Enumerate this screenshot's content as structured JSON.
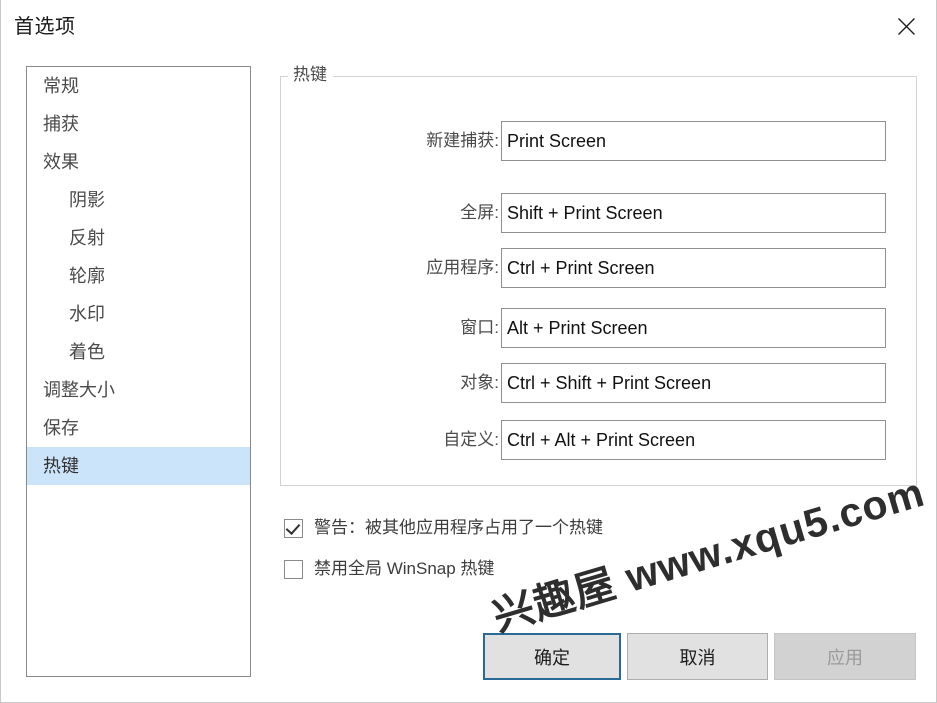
{
  "window": {
    "title": "首选项",
    "close_icon": "close-icon"
  },
  "sidebar": {
    "items": [
      {
        "label": "常规",
        "indent": false,
        "selected": false
      },
      {
        "label": "捕获",
        "indent": false,
        "selected": false
      },
      {
        "label": "效果",
        "indent": false,
        "selected": false
      },
      {
        "label": "阴影",
        "indent": true,
        "selected": false
      },
      {
        "label": "反射",
        "indent": true,
        "selected": false
      },
      {
        "label": "轮廓",
        "indent": true,
        "selected": false
      },
      {
        "label": "水印",
        "indent": true,
        "selected": false
      },
      {
        "label": "着色",
        "indent": true,
        "selected": false
      },
      {
        "label": "调整大小",
        "indent": false,
        "selected": false
      },
      {
        "label": "保存",
        "indent": false,
        "selected": false
      },
      {
        "label": "热键",
        "indent": false,
        "selected": true
      }
    ],
    "selected_label": "热键",
    "highlight_color": "#cce4fa"
  },
  "hotkey_group": {
    "legend": "热键",
    "rows": [
      {
        "label": "新建捕获:",
        "value": "Print Screen",
        "placeholder": ""
      },
      {
        "label": "全屏:",
        "value": "Shift + Print Screen",
        "placeholder": ""
      },
      {
        "label": "应用程序:",
        "value": "Ctrl + Print Screen",
        "placeholder": ""
      },
      {
        "label": "窗口:",
        "value": "Alt + Print Screen",
        "placeholder": ""
      },
      {
        "label": "对象:",
        "value": "Ctrl + Shift + Print Screen",
        "placeholder": ""
      },
      {
        "label": "自定义:",
        "value": "Ctrl + Alt + Print Screen",
        "placeholder": ""
      }
    ]
  },
  "options": {
    "checkboxes": [
      {
        "label": "警告：被其他应用程序占用了一个热键",
        "checked": true
      },
      {
        "label": "禁用全局 WinSnap 热键",
        "checked": false
      }
    ]
  },
  "buttons": {
    "ok": "确定",
    "cancel": "取消",
    "apply": "应用",
    "apply_disabled": true,
    "focus_color": "#2a6b96"
  },
  "watermark": {
    "text": "兴趣屋 www.xqu5.com"
  }
}
